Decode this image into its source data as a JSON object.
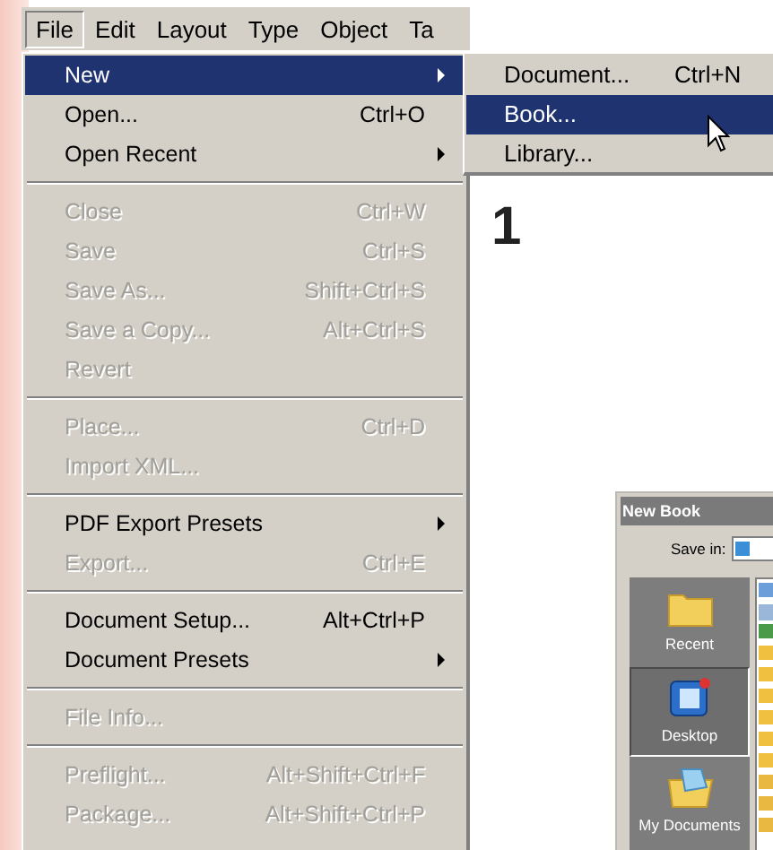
{
  "menubar": [
    {
      "label": "File",
      "selected": true
    },
    {
      "label": "Edit",
      "selected": false
    },
    {
      "label": "Layout",
      "selected": false
    },
    {
      "label": "Type",
      "selected": false
    },
    {
      "label": "Object",
      "selected": false
    },
    {
      "label": "Ta",
      "selected": false
    }
  ],
  "file_menu": [
    {
      "kind": "item",
      "label": "New",
      "selected": true,
      "disabled": false,
      "submenu": true
    },
    {
      "kind": "item",
      "label": "Open...",
      "shortcut": "Ctrl+O",
      "selected": false,
      "disabled": false,
      "submenu": false
    },
    {
      "kind": "item",
      "label": "Open Recent",
      "selected": false,
      "disabled": false,
      "submenu": true
    },
    {
      "kind": "separator"
    },
    {
      "kind": "item",
      "label": "Close",
      "shortcut": "Ctrl+W",
      "selected": false,
      "disabled": true,
      "submenu": false
    },
    {
      "kind": "item",
      "label": "Save",
      "shortcut": "Ctrl+S",
      "selected": false,
      "disabled": true,
      "submenu": false
    },
    {
      "kind": "item",
      "label": "Save As...",
      "shortcut": "Shift+Ctrl+S",
      "selected": false,
      "disabled": true,
      "submenu": false
    },
    {
      "kind": "item",
      "label": "Save a Copy...",
      "shortcut": "Alt+Ctrl+S",
      "selected": false,
      "disabled": true,
      "submenu": false
    },
    {
      "kind": "item",
      "label": "Revert",
      "selected": false,
      "disabled": true,
      "submenu": false
    },
    {
      "kind": "separator"
    },
    {
      "kind": "item",
      "label": "Place...",
      "shortcut": "Ctrl+D",
      "selected": false,
      "disabled": true,
      "submenu": false
    },
    {
      "kind": "item",
      "label": "Import XML...",
      "selected": false,
      "disabled": true,
      "submenu": false
    },
    {
      "kind": "separator"
    },
    {
      "kind": "item",
      "label": "PDF Export Presets",
      "selected": false,
      "disabled": false,
      "submenu": true
    },
    {
      "kind": "item",
      "label": "Export...",
      "shortcut": "Ctrl+E",
      "selected": false,
      "disabled": true,
      "submenu": false
    },
    {
      "kind": "separator"
    },
    {
      "kind": "item",
      "label": "Document Setup...",
      "shortcut": "Alt+Ctrl+P",
      "selected": false,
      "disabled": false,
      "submenu": false
    },
    {
      "kind": "item",
      "label": "Document Presets",
      "selected": false,
      "disabled": false,
      "submenu": true
    },
    {
      "kind": "separator"
    },
    {
      "kind": "item",
      "label": "File Info...",
      "selected": false,
      "disabled": true,
      "submenu": false
    },
    {
      "kind": "separator"
    },
    {
      "kind": "item",
      "label": "Preflight...",
      "shortcut": "Alt+Shift+Ctrl+F",
      "selected": false,
      "disabled": true,
      "submenu": false
    },
    {
      "kind": "item",
      "label": "Package...",
      "shortcut": "Alt+Shift+Ctrl+P",
      "selected": false,
      "disabled": true,
      "submenu": false
    }
  ],
  "new_submenu": [
    {
      "label": "Document...",
      "shortcut": "Ctrl+N",
      "selected": false
    },
    {
      "label": "Book...",
      "selected": true
    },
    {
      "label": "Library...",
      "selected": false
    }
  ],
  "step_number": "1",
  "dialog": {
    "title": "New Book",
    "save_in_label": "Save in:",
    "places": [
      {
        "label": "Recent",
        "selected": false
      },
      {
        "label": "Desktop",
        "selected": true
      },
      {
        "label": "My Documents",
        "selected": false
      }
    ]
  }
}
